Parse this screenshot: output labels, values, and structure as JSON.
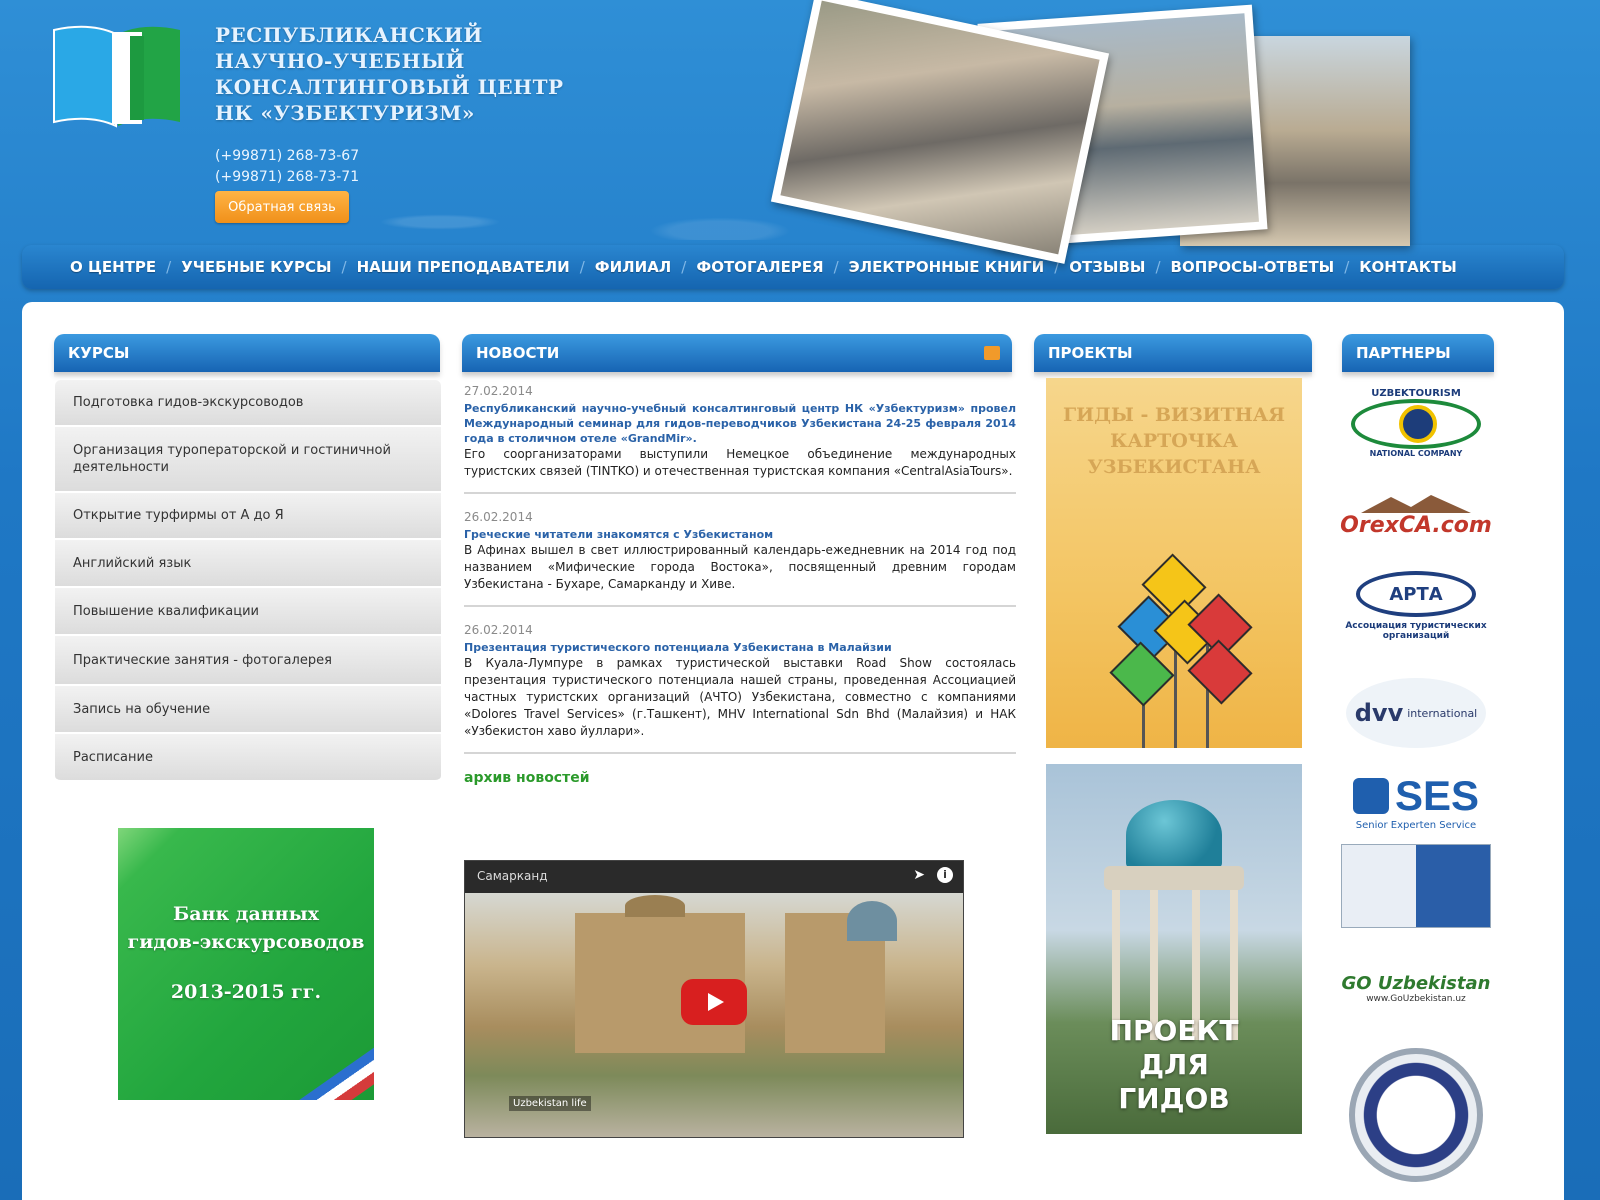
{
  "header": {
    "org_name_lines": [
      "РЕСПУБЛИКАНСКИЙ",
      "НАУЧНО-УЧЕБНЫЙ",
      "КОНСАЛТИНГОВЫЙ ЦЕНТР",
      "НК «УЗБЕКТУРИЗМ»"
    ],
    "phones": [
      "(+99871) 268-73-67",
      "(+99871) 268-73-71"
    ],
    "feedback_label": "Обратная связь"
  },
  "nav": {
    "items": [
      "О ЦЕНТРЕ",
      "УЧЕБНЫЕ КУРСЫ",
      "НАШИ ПРЕПОДАВАТЕЛИ",
      "ФИЛИАЛ",
      "ФОТОГАЛЕРЕЯ",
      "ЭЛЕКТРОННЫЕ КНИГИ",
      "ОТЗЫВЫ",
      "ВОПРОСЫ-ОТВЕТЫ",
      "КОНТАКТЫ"
    ],
    "separator": "/"
  },
  "courses": {
    "title": "КУРСЫ",
    "items": [
      "Подготовка гидов-экскурсоводов",
      "Организация туроператорской и гостиничной деятельности",
      "Открытие турфирмы от А до Я",
      "Английский язык",
      "Повышение квалификации",
      "Практические занятия - фотогалерея",
      "Запись на обучение",
      "Расписание"
    ]
  },
  "guides_banner": {
    "line1": "Банк данных",
    "line2": "гидов-экскурсоводов",
    "year": "2013-2015 гг."
  },
  "news": {
    "title": "НОВОСТИ",
    "items": [
      {
        "date": "27.02.2014",
        "title": "Республиканский научно-учебный консалтинговый центр НК «Узбектуризм» провел Международный семинар для гидов-переводчиков Узбекистана 24-25 февраля 2014 года в столичном отеле «GrandMir».",
        "text": "Его соорганизаторами выступили Немецкое объединение международных туристских связей (TINTKO) и отечественная туристская компания «CentralAsiaTours»."
      },
      {
        "date": "26.02.2014",
        "title": "Греческие читатели знакомятся с Узбекистаном",
        "text": "В Афинах вышел в свет иллюстрированный календарь-ежедневник на 2014 год под названием «Мифические города Востока», посвященный древним городам Узбекистана - Бухаре, Самарканду и Хиве."
      },
      {
        "date": "26.02.2014",
        "title": "Презентация туристического потенциала Узбекистана в Малайзии",
        "text": "В Куала-Лумпуре в рамках туристической выставки Road Show состоялась презентация туристического потенциала нашей страны, проведенная Ассоциацией частных туристских организаций (АЧТО) Узбекистана, совместно с компаниями «Dolores Travel Services» (г.Ташкент), MHV International Sdn Bhd (Малайзия) и НАК «Узбекистон хаво йуллари»."
      }
    ],
    "archive_label": "архив новостей"
  },
  "video": {
    "title": "Самарканд",
    "watermark": "Uzbekistan life"
  },
  "projects": {
    "title": "ПРОЕКТЫ",
    "book_title_lines": [
      "ГИДЫ - ВИЗИТНАЯ",
      "КАРТОЧКА",
      "УЗБЕКИСТАНА"
    ],
    "guides_project_lines": [
      "ПРОЕКТ",
      "ДЛЯ",
      "ГИДОВ"
    ]
  },
  "partners": {
    "title": "ПАРТНЕРЫ",
    "uzbektourism_top": "UZBEKTOURISM",
    "uzbektourism_bottom": "NATIONAL COMPANY",
    "orexca": "OrexCA.com",
    "apta": "АРТА",
    "apta_sub": "Ассоциация туристических организаций",
    "dvv": "dvv",
    "dvv_sub": "international",
    "ses": "SES",
    "ses_sub": "Senior Experten Service",
    "go_uzbekistan": "GO Uzbekistan",
    "go_uzbekistan_url": "www.GoUzbekistan.uz"
  },
  "colors": {
    "brand_blue": "#1f78c5",
    "nav_blue": "#1565b0",
    "accent_orange": "#f0901a",
    "link_blue": "#2a62a8",
    "archive_green": "#2b9a2b"
  }
}
